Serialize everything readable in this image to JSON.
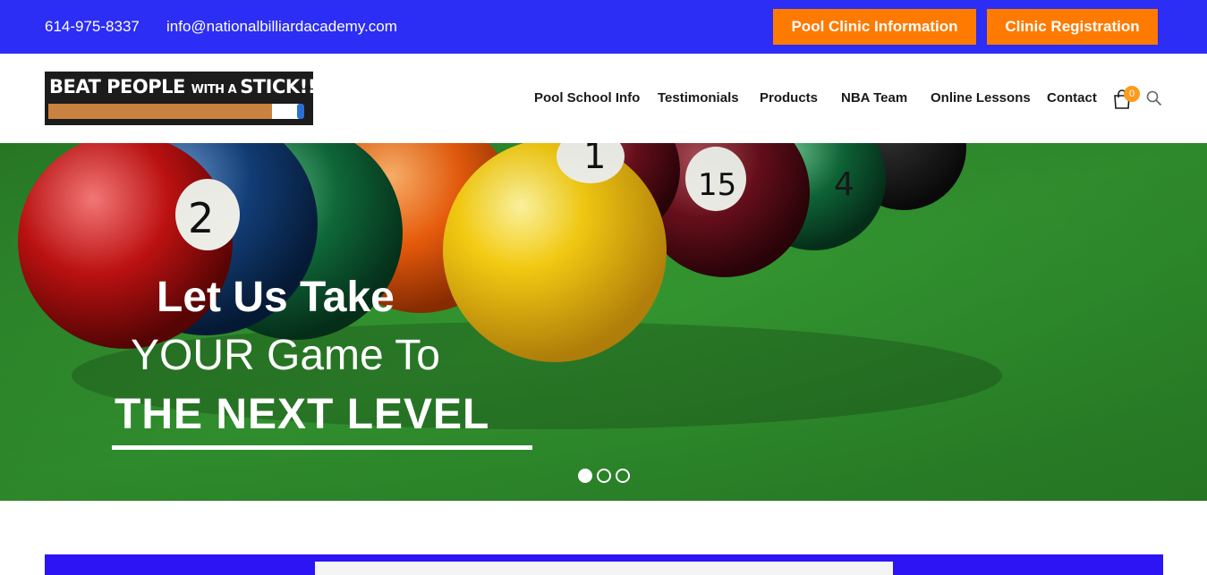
{
  "topbar": {
    "phone": "614-975-8337",
    "email": "info@nationalbilliardacademy.com",
    "clinic_info_label": "Pool Clinic Information",
    "clinic_registration_label": "Clinic Registration"
  },
  "logo": {
    "text_main": "BEAT PEOPLE ",
    "text_small": "WITH A ",
    "text_end": "STICK!!"
  },
  "nav": {
    "items": [
      "Pool School Info",
      "Testimonials",
      "Products",
      "NBA Team",
      "Online Lessons",
      "Contact"
    ]
  },
  "cart": {
    "count": "0",
    "icon": "shopping-bag-icon"
  },
  "search": {
    "icon": "search-icon"
  },
  "hero": {
    "line1": "Let Us Take",
    "line2": "YOUR Game To",
    "line3": "THE NEXT LEVEL",
    "slides": 3,
    "active_slide": 1
  },
  "colors": {
    "topbar": "#2c2df5",
    "button": "#ff7a00",
    "felt": "#2e8e2c",
    "badge": "#ff9a1a"
  }
}
